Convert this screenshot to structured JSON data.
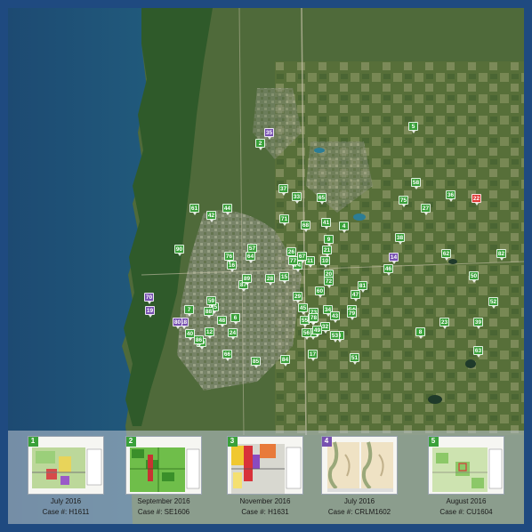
{
  "colors": {
    "frame": "#1f4a80",
    "marker_green": "#3aa13a",
    "marker_purple": "#7750b0",
    "marker_red": "#e03a36",
    "water": "#2c7d95",
    "land": "#4f6a3a"
  },
  "markers": [
    {
      "label": "2",
      "color": "green"
    },
    {
      "label": "3",
      "color": "green"
    },
    {
      "label": "4",
      "color": "green"
    },
    {
      "label": "5",
      "color": "green"
    },
    {
      "label": "6",
      "color": "green"
    },
    {
      "label": "7",
      "color": "green"
    },
    {
      "label": "8",
      "color": "green"
    },
    {
      "label": "9",
      "color": "green"
    },
    {
      "label": "10",
      "color": "green"
    },
    {
      "label": "11",
      "color": "green"
    },
    {
      "label": "12",
      "color": "green"
    },
    {
      "label": "13",
      "color": "green"
    },
    {
      "label": "14",
      "color": "purple"
    },
    {
      "label": "15",
      "color": "green"
    },
    {
      "label": "16",
      "color": "green"
    },
    {
      "label": "17",
      "color": "green"
    },
    {
      "label": "18",
      "color": "purple"
    },
    {
      "label": "19",
      "color": "purple"
    },
    {
      "label": "20",
      "color": "green"
    },
    {
      "label": "21",
      "color": "green"
    },
    {
      "label": "22",
      "color": "red"
    },
    {
      "label": "23",
      "color": "green"
    },
    {
      "label": "24",
      "color": "green"
    },
    {
      "label": "25",
      "color": "green"
    },
    {
      "label": "26",
      "color": "green"
    },
    {
      "label": "27",
      "color": "green"
    },
    {
      "label": "28",
      "color": "green"
    },
    {
      "label": "29",
      "color": "green"
    },
    {
      "label": "30",
      "color": "green"
    },
    {
      "label": "32",
      "color": "green"
    },
    {
      "label": "33",
      "color": "green"
    },
    {
      "label": "34",
      "color": "green"
    },
    {
      "label": "35",
      "color": "purple"
    },
    {
      "label": "36",
      "color": "green"
    },
    {
      "label": "37",
      "color": "green"
    },
    {
      "label": "38",
      "color": "green"
    },
    {
      "label": "39",
      "color": "green"
    },
    {
      "label": "40",
      "color": "green"
    },
    {
      "label": "41",
      "color": "green"
    },
    {
      "label": "42",
      "color": "green"
    },
    {
      "label": "43",
      "color": "green"
    },
    {
      "label": "44",
      "color": "green"
    },
    {
      "label": "45",
      "color": "green"
    },
    {
      "label": "46",
      "color": "green"
    },
    {
      "label": "47",
      "color": "green"
    },
    {
      "label": "48",
      "color": "green"
    },
    {
      "label": "49",
      "color": "green"
    },
    {
      "label": "50",
      "color": "green"
    },
    {
      "label": "51",
      "color": "green"
    },
    {
      "label": "52",
      "color": "green"
    },
    {
      "label": "53",
      "color": "green"
    },
    {
      "label": "54",
      "color": "green"
    },
    {
      "label": "55",
      "color": "green"
    },
    {
      "label": "56",
      "color": "green"
    },
    {
      "label": "57",
      "color": "green"
    },
    {
      "label": "58",
      "color": "green"
    },
    {
      "label": "59",
      "color": "green"
    },
    {
      "label": "60",
      "color": "green"
    },
    {
      "label": "61",
      "color": "green"
    },
    {
      "label": "62",
      "color": "green"
    },
    {
      "label": "63",
      "color": "green"
    },
    {
      "label": "64",
      "color": "green"
    },
    {
      "label": "65",
      "color": "green"
    },
    {
      "label": "66",
      "color": "green"
    },
    {
      "label": "67",
      "color": "green"
    },
    {
      "label": "68",
      "color": "green"
    },
    {
      "label": "69",
      "color": "green"
    },
    {
      "label": "70",
      "color": "purple"
    },
    {
      "label": "71",
      "color": "green"
    },
    {
      "label": "72",
      "color": "green"
    },
    {
      "label": "73",
      "color": "green"
    },
    {
      "label": "74",
      "color": "green"
    },
    {
      "label": "75",
      "color": "green"
    },
    {
      "label": "76",
      "color": "green"
    },
    {
      "label": "77",
      "color": "green"
    },
    {
      "label": "78",
      "color": "green"
    },
    {
      "label": "79",
      "color": "green"
    },
    {
      "label": "80",
      "color": "purple"
    },
    {
      "label": "81",
      "color": "green"
    },
    {
      "label": "82",
      "color": "green"
    },
    {
      "label": "84",
      "color": "green"
    },
    {
      "label": "85",
      "color": "green"
    },
    {
      "label": "86",
      "color": "green"
    },
    {
      "label": "87",
      "color": "green"
    },
    {
      "label": "88",
      "color": "green"
    },
    {
      "label": "89",
      "color": "green"
    },
    {
      "label": "90",
      "color": "green"
    }
  ],
  "cases": [
    {
      "number": "1",
      "date": "July 2016",
      "case": "Case #:  H1611",
      "color": "green"
    },
    {
      "number": "2",
      "date": "September 2016",
      "case": "Case #:  SE1606",
      "color": "green"
    },
    {
      "number": "3",
      "date": "November 2016",
      "case": "Case #:  H1631",
      "color": "green"
    },
    {
      "number": "4",
      "date": "July 2016",
      "case": "Case #:  CRLM1602",
      "color": "purple"
    },
    {
      "number": "5",
      "date": "August 2016",
      "case": "Case #:  CU1604",
      "color": "green"
    }
  ]
}
